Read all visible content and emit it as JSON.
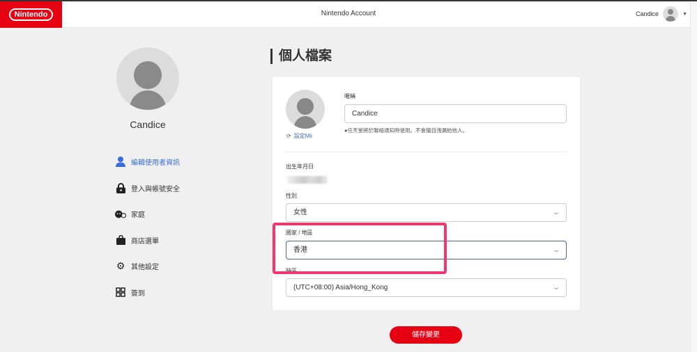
{
  "header": {
    "logo": "Nintendo",
    "title": "Nintendo Account",
    "user_name": "Candice"
  },
  "sidebar": {
    "user_name": "Candice",
    "items": [
      {
        "label": "編輯使用者資訊",
        "icon": "user-icon",
        "active": true
      },
      {
        "label": "登入與帳號安全",
        "icon": "lock-icon"
      },
      {
        "label": "家庭",
        "icon": "family-icon"
      },
      {
        "label": "商店選單",
        "icon": "shopping-bag-icon"
      },
      {
        "label": "其他設定",
        "icon": "gear-icon"
      },
      {
        "label": "簽到",
        "icon": "qr-code-icon"
      }
    ]
  },
  "main": {
    "title": "個人檔案",
    "mii_link": "設定Mii",
    "nickname_label": "暱稱",
    "nickname_value": "Candice",
    "nickname_hint": "●任天堂將於聯絡通知時使用。不會擅自洩漏給他人。",
    "birthday_label": "出生年月日",
    "gender_label": "性別",
    "gender_value": "女性",
    "country_label": "國家 / 地區",
    "country_value": "香港",
    "timezone_label": "時區",
    "timezone_value": "(UTC+08:00) Asia/Hong_Kong",
    "save_label": "儲存變更"
  },
  "colors": {
    "brand": "#e60012",
    "link": "#3a6dd8",
    "highlight": "#f0376e"
  }
}
